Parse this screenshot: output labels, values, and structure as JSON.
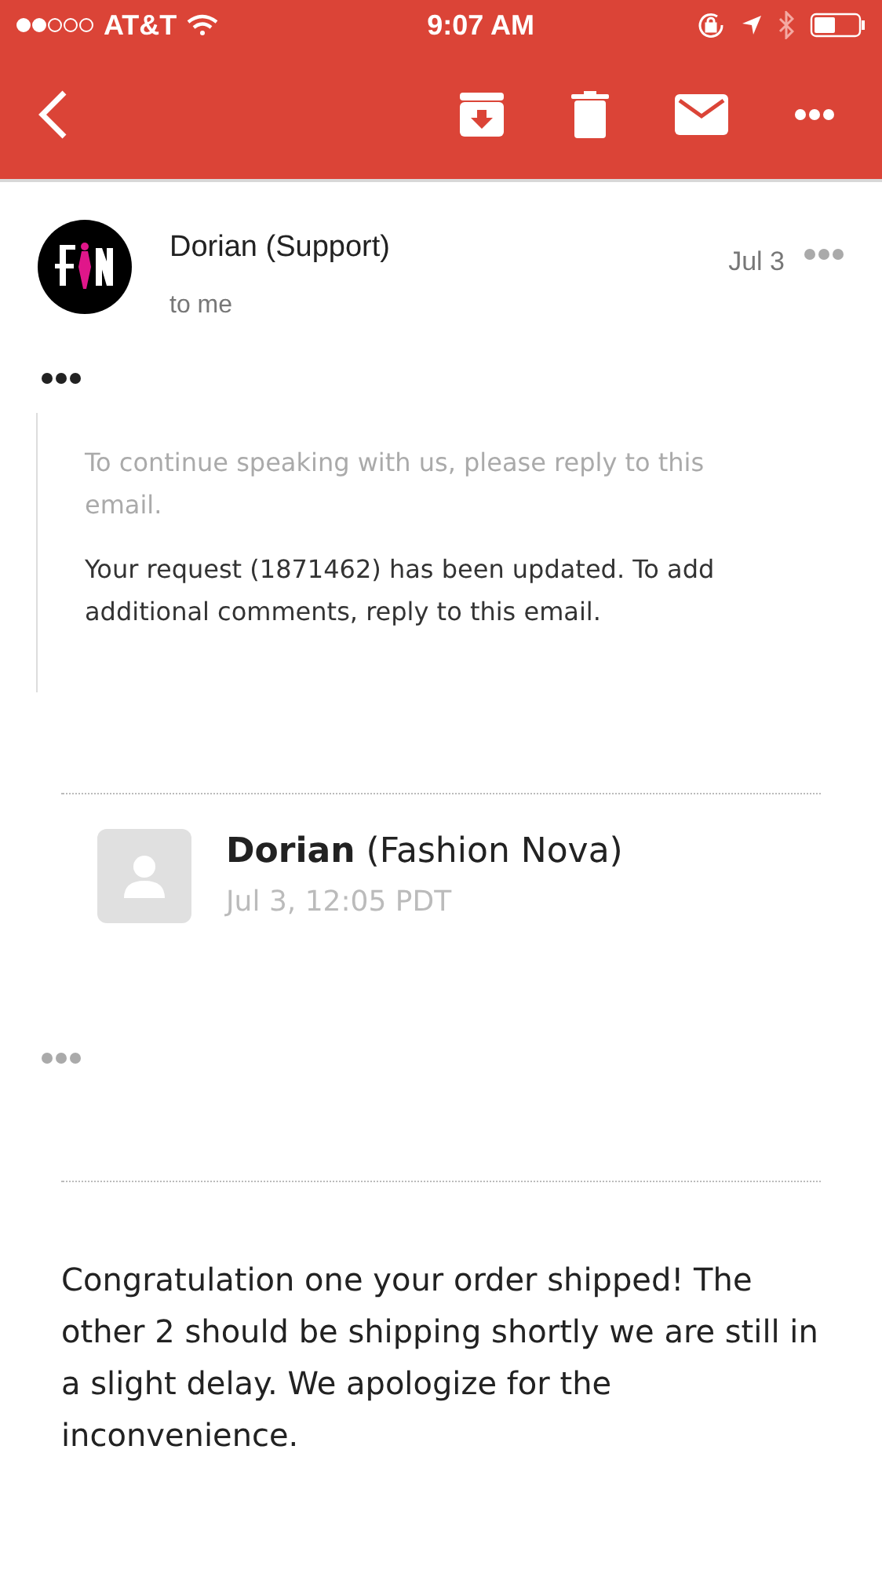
{
  "status_bar": {
    "carrier": "AT&T",
    "time": "9:07 AM"
  },
  "message": {
    "sender": "Dorian (Support)",
    "recipient": "to me",
    "date": "Jul 3"
  },
  "quoted": {
    "paragraphs": [
      {
        "text": "To continue speaking with us, please reply to this email.",
        "kind": "muted"
      },
      {
        "text": "Your request (1871462) has been updated. To add additional comments, reply to this email.",
        "kind": "normal"
      }
    ]
  },
  "reply_header": {
    "sender": "**Dorian** (Fashion Nova)",
    "timestamp": "Jul 3, 12:05 PDT"
  },
  "body": "Congratulation one your order shipped! The other 2 should be shipping shortly we are still in a slight delay. We apologize for the inconvenience."
}
